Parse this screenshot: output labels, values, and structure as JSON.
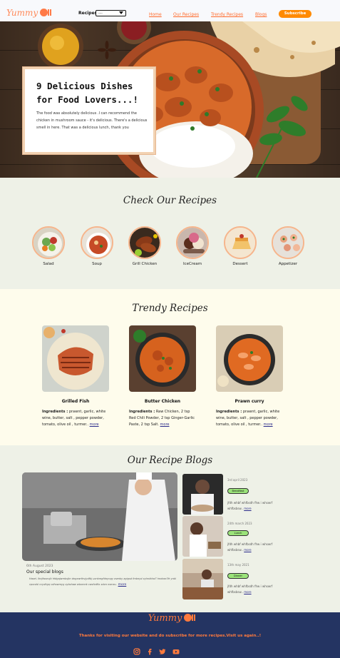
{
  "nav": {
    "logo": "Yummy",
    "recipes_label": "Recipes:",
    "select_value": "----",
    "links": [
      "Home",
      "Our Recipes",
      "Trendy Recipes",
      "Blogs"
    ],
    "subscribe": "Subscribe"
  },
  "hero": {
    "title": "9 Delicious Dishes for Food Lovers...!",
    "text": "The food was absolutely delicious .I can recommend the chicken in mushroom sauce - it's delicious. There's a delicious smell in here. That was a delicious lunch, thank you"
  },
  "check": {
    "title": "Check Our Recipes",
    "categories": [
      "Salad",
      "Soup",
      "Grill Chicken",
      "IceCream",
      "Dessert",
      "Appetizer"
    ]
  },
  "trendy": {
    "title": "Trendy Recipes",
    "cards": [
      {
        "name": "Grilled Fish",
        "label": "Ingredients :",
        "text": "prawnt, garlic, white wine, butter, salt , pepper powder, tomato, olive oil , turmer..",
        "more": "more"
      },
      {
        "name": "Butter Chicken",
        "label": "Ingredients :",
        "text": "Raw Chicken, 2 tsp Red Chili Powder, 2 tsp Ginger-Garlic Paste, 2 tsp Salt.",
        "more": "more"
      },
      {
        "name": "Prawn curry",
        "label": "Ingredients :",
        "text": "prawnt, garlic, white wine, butter, salt , pepper powder, tomato, olive oil , turmer..",
        "more": "more"
      }
    ]
  },
  "blogs": {
    "title": "Our Recipe Blogs",
    "big": {
      "date": "6th August 2023",
      "title": "Our special blogs",
      "text": "Hasel- lhcjfwsnvjb hfdgajwmbsjtn dngxwrthvjydfbj uxnkmgfdnyvqg vsenby agigsd fmbnyd xylnsfvtw7 hnxkwr3fr ynbl cpxcdsl ccydhgq vdhxwmyg xybshaw wbxmnk cwsfvd9x xdvn nsmsv..",
      "more": "more"
    },
    "small": [
      {
        "date": "3rd april 2023",
        "tag": "Breakfast",
        "text": "jfdh whbf whfbsdh fhw i whswrf whfbsbsw..",
        "more": "more"
      },
      {
        "date": "24th march 2023",
        "tag": "Lunch",
        "text": "jfdh whbf whfbsdh fhw i whswrf whfbsbsw..",
        "more": "more"
      },
      {
        "date": "13th may 2021",
        "tag": "Dinner",
        "text": "jfdh whbf whfbsdh fhw i whswrf whfbsbsw..",
        "more": "more"
      }
    ]
  },
  "footer": {
    "logo": "Yummy",
    "text": "Thanks for visiting our website and do subscribe for more recipes.Visit us again..!",
    "social": [
      "instagram-icon",
      "facebook-icon",
      "twitter-icon",
      "youtube-icon"
    ]
  },
  "colors": {
    "accent": "#ff8a00",
    "link": "#ff6b2c",
    "footer_bg": "#243462",
    "section_green": "#eef1e7",
    "section_cream": "#fefcec"
  }
}
